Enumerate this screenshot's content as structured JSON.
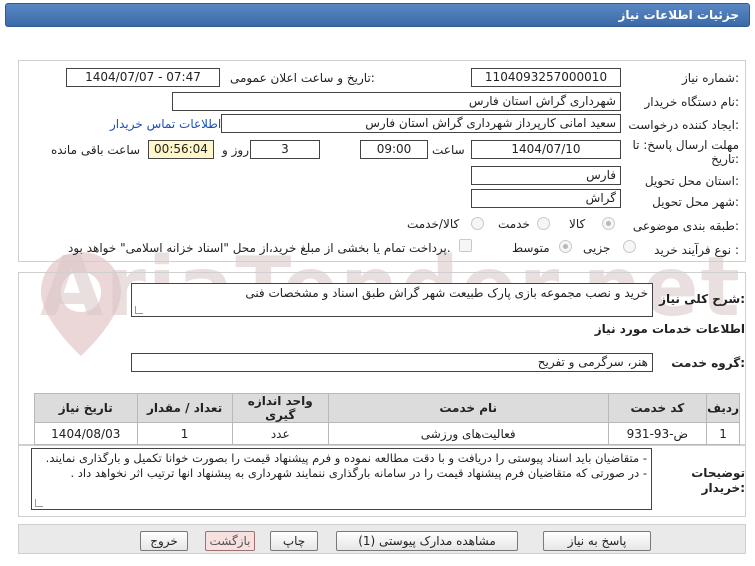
{
  "title": "جزئیات اطلاعات نیاز",
  "watermark": "AriaTender.net",
  "fields": {
    "need_number_label": "شماره نیاز:",
    "need_number": "1104093257000010",
    "announce_label": "تاریخ و ساعت اعلان عمومی:",
    "announce_value": "1404/07/07 - 07:47",
    "buyer_org_label": "نام دستگاه خریدار:",
    "buyer_org": "شهرداری گراش استان فارس",
    "creator_label": "ایجاد کننده درخواست:",
    "creator": "سعید امانی کارپرداز شهرداری گراش استان فارس",
    "contact_link": "اطلاعات تماس خریدار",
    "deadline_label_1": "مهلت ارسال پاسخ: تا",
    "deadline_label_2": "تاریخ:",
    "deadline_date": "1404/07/10",
    "time_label": "ساعت",
    "deadline_time": "09:00",
    "days_value": "3",
    "days_label": "روز و",
    "remaining_time": "00:56:04",
    "remaining_label": "ساعت باقی مانده",
    "province_label": "استان محل تحویل:",
    "province": "فارس",
    "city_label": "شهر محل تحویل:",
    "city": "گراش",
    "category_label": "طبقه بندی موضوعی:",
    "category_options": [
      "کالا",
      "خدمت",
      "کالا/خدمت"
    ],
    "process_label": "نوع فرآیند خرید :",
    "process_options": [
      "جزیی",
      "متوسط"
    ],
    "payment_note": "پرداخت تمام یا بخشی از مبلغ خرید،از محل \"اسناد خزانه اسلامی\" خواهد بود."
  },
  "summary": {
    "label": "شرح کلی نیاز:",
    "value": "خرید و نصب مجموعه بازی پارک طبیعت شهر گراش طبق اسناد و مشخصات فنی"
  },
  "services": {
    "section_title": "اطلاعات خدمات مورد نیاز",
    "group_label": "گروه خدمت:",
    "group_value": "هنر، سرگرمی و تفریح",
    "headers": [
      "ردیف",
      "کد خدمت",
      "نام خدمت",
      "واحد اندازه گیری",
      "تعداد / مقدار",
      "تاریخ نیاز"
    ],
    "rows": [
      [
        "1",
        "ض-93-931",
        "فعالیت‌های ورزشی",
        "عدد",
        "1",
        "1404/08/03"
      ]
    ]
  },
  "notes": {
    "label_1": "توضیحات",
    "label_2": "خریدار:",
    "line_1": "- متقاضیان باید اسناد پیوستی را دریافت و با دقت مطالعه نموده و فرم پیشنهاد قیمت را بصورت خوانا تکمیل و بارگذاری نمایند.",
    "line_2": "- در صورتی که متقاضیان فرم پیشنهاد قیمت را در سامانه بارگذاری ننمایند شهرداری به پیشنهاد انها ترتیب اثر نخواهد داد ."
  },
  "buttons": {
    "reply": "پاسخ به نیاز",
    "attachments": "مشاهده مدارک پیوستی (1)",
    "print": "چاپ",
    "back": "بازگشت",
    "exit": "خروج"
  }
}
